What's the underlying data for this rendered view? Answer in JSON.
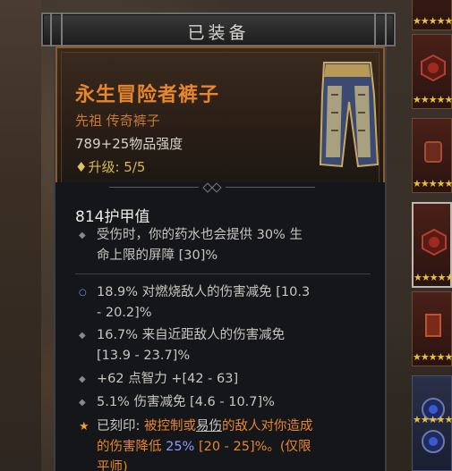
{
  "header": {
    "title": "已装备"
  },
  "item": {
    "name": "永生冒险者裤子",
    "subtitle": "先祖 传奇裤子",
    "power": "789+25物品强度",
    "upgrade_icon": "♦",
    "upgrade": "升级: 5/5"
  },
  "armor": "814护甲值",
  "implicit": {
    "line1": "受伤时，你的药水也会提供 30% 生",
    "line2": "命上限的屏障 [30]%"
  },
  "affixes": [
    {
      "icon": "ring-icon",
      "line1": "18.9% 对燃烧敌人的伤害减免 [10.3",
      "line2": "- 20.2]%"
    },
    {
      "icon": "diamond-icon",
      "line1": "16.7% 来自近距敌人的伤害减免",
      "line2": "[13.9 - 23.7]%"
    },
    {
      "icon": "diamond-icon",
      "line1": "+62 点智力 +[42 - 63]"
    },
    {
      "icon": "diamond-icon",
      "line1": "5.1% 伤害减免 [4.6 - 10.7]%"
    }
  ],
  "aspect": {
    "prefix": "已刻印: ",
    "part1": "被控制或",
    "part2": "易伤",
    "part3": "的敌人对你造成",
    "line2a": "的伤害降低 ",
    "value": "25%",
    "line2b": " [20 - 25]%。(仅限",
    "line3": "平师)"
  },
  "colors": {
    "legendary": "#e8862c",
    "value_blue": "#8a9cff",
    "gold": "#d9b55a"
  },
  "slots": [
    {
      "stars": "★★★★★"
    },
    {
      "stars": "★★★★★"
    },
    {
      "stars": "★★★★★"
    },
    {
      "stars": "★★★★★"
    },
    {
      "stars": "★★★★★"
    },
    {
      "stars": "★★★★★"
    }
  ]
}
